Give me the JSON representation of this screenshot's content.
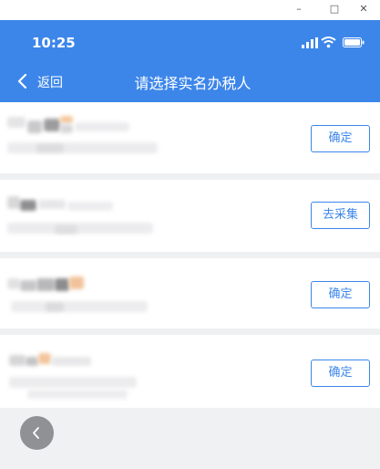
{
  "window": {
    "minimize_glyph": "–",
    "maximize_glyph": "□",
    "close_glyph": "✕"
  },
  "status_bar": {
    "time": "10:25",
    "icons": [
      "signal-icon",
      "wifi-icon",
      "battery-icon"
    ]
  },
  "nav": {
    "back_label": "返回",
    "title": "请选择实名办税人"
  },
  "taxpayers": [
    {
      "action_label": "确定"
    },
    {
      "action_label": "去采集"
    },
    {
      "action_label": "确定"
    },
    {
      "action_label": "确定"
    }
  ],
  "floating_back": {
    "icon": "chevron-left-icon"
  },
  "colors": {
    "header_bg": "#3c86ea",
    "accent": "#3c86ea",
    "page_bg": "#f0f1f3"
  }
}
